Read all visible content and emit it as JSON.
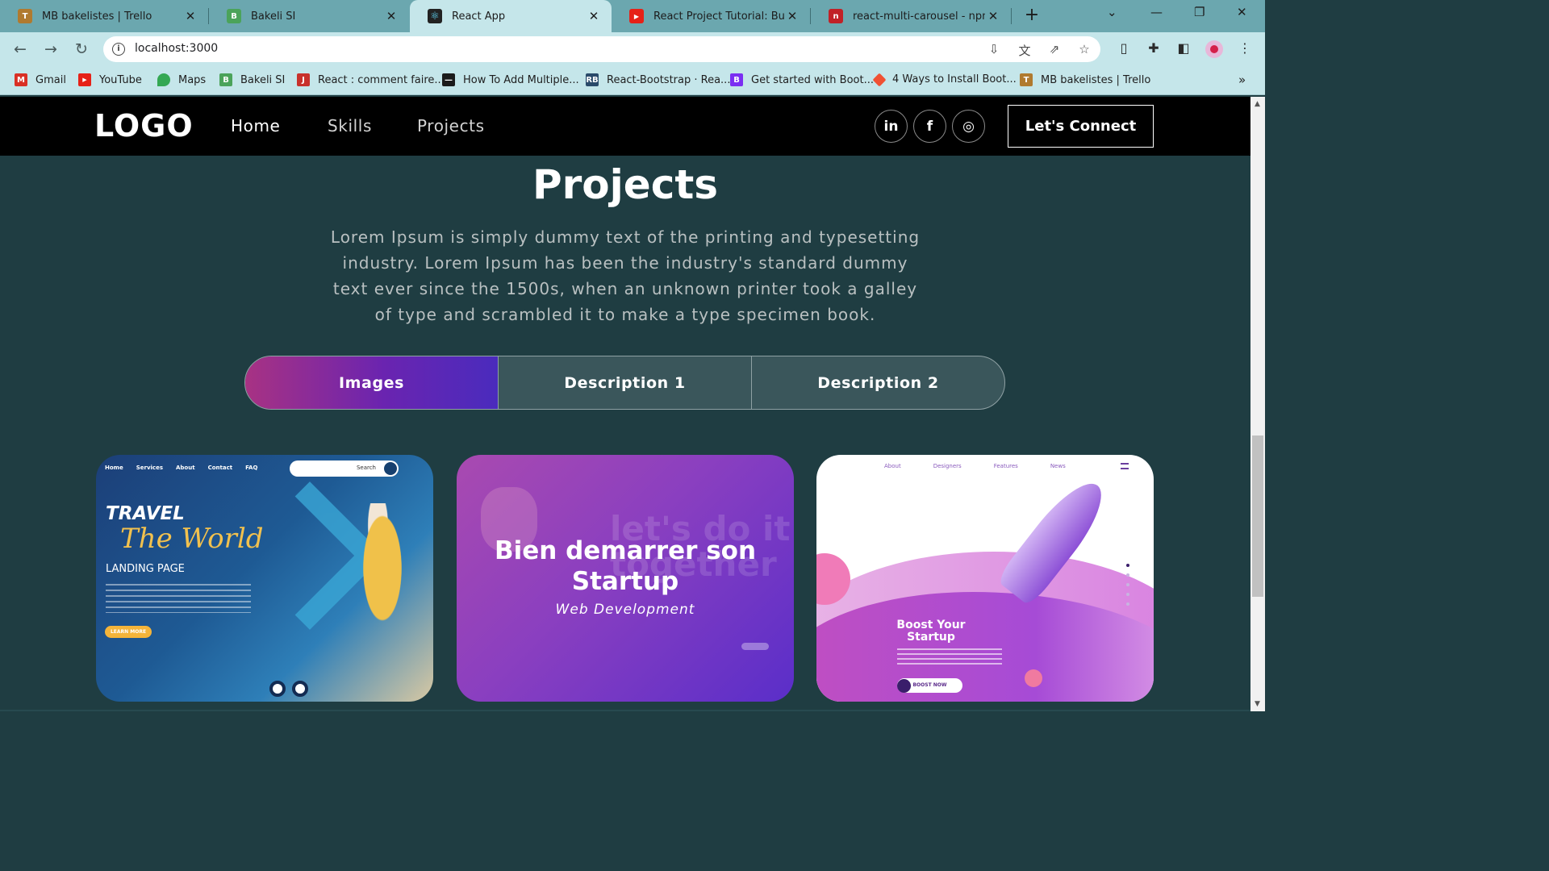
{
  "browser": {
    "tabs": [
      {
        "title": "MB bakelistes | Trello",
        "icon": "trello-icon",
        "color": "#b07a2f",
        "active": false
      },
      {
        "title": "Bakeli SI",
        "icon": "bakeli-icon",
        "color": "#4ba35a",
        "active": false
      },
      {
        "title": "React App",
        "icon": "react-icon",
        "color": "#222222",
        "active": true
      },
      {
        "title": "React Project Tutorial: Build a",
        "icon": "youtube-icon",
        "color": "#e62117",
        "active": false
      },
      {
        "title": "react-multi-carousel - npm",
        "icon": "npm-icon",
        "color": "#c12127",
        "active": false
      }
    ],
    "url": "localhost:3000",
    "bookmarks": [
      {
        "label": "Gmail",
        "icon": "gmail-icon",
        "color": "#d93025"
      },
      {
        "label": "YouTube",
        "icon": "youtube-icon",
        "color": "#e62117"
      },
      {
        "label": "Maps",
        "icon": "maps-icon",
        "color": "#34a853"
      },
      {
        "label": "Bakeli SI",
        "icon": "bakeli-icon",
        "color": "#4ba35a"
      },
      {
        "label": "React : comment faire...",
        "icon": "j-icon",
        "color": "#c8312b"
      },
      {
        "label": "How To Add Multiple...",
        "icon": "dark-site-icon",
        "color": "#1b1b1b"
      },
      {
        "label": "React-Bootstrap · Rea...",
        "icon": "react-bootstrap-icon",
        "color": "#2a4a6a"
      },
      {
        "label": "Get started with Boot...",
        "icon": "bootstrap-icon",
        "color": "#7b2ff2"
      },
      {
        "label": "4 Ways to Install Boot...",
        "icon": "git-icon",
        "color": "#f05133"
      },
      {
        "label": "MB bakelistes | Trello",
        "icon": "trello-icon",
        "color": "#b07a2f"
      }
    ]
  },
  "site": {
    "logo": "LOGO",
    "nav": [
      "Home",
      "Skills",
      "Projects"
    ],
    "social": [
      "in",
      "f",
      "◎"
    ],
    "connect_label": "Let's Connect"
  },
  "projects": {
    "title": "Projects",
    "description": "Lorem Ipsum is simply dummy text of the printing and typesetting industry. Lorem Ipsum has been the industry's standard dummy text ever since the 1500s, when an unknown printer took a galley of type and scrambled it to make a type specimen book.",
    "tabs": [
      "Images",
      "Description 1",
      "Description 2"
    ],
    "active_tab": "Images",
    "cards": [
      {
        "menu": [
          "Home",
          "Services",
          "About",
          "Contact",
          "FAQ"
        ],
        "search": "Search",
        "title1": "TRAVEL",
        "title2": "The World",
        "title3": "LANDING PAGE",
        "button": "LEARN MORE"
      },
      {
        "bg_text": "let's do it together",
        "heading": "Bien demarrer son Startup",
        "subheading": "Web Development"
      },
      {
        "menu": [
          "About",
          "Designers",
          "Features",
          "News"
        ],
        "heading": "Boost Your Startup",
        "button": "BOOST NOW"
      }
    ]
  }
}
